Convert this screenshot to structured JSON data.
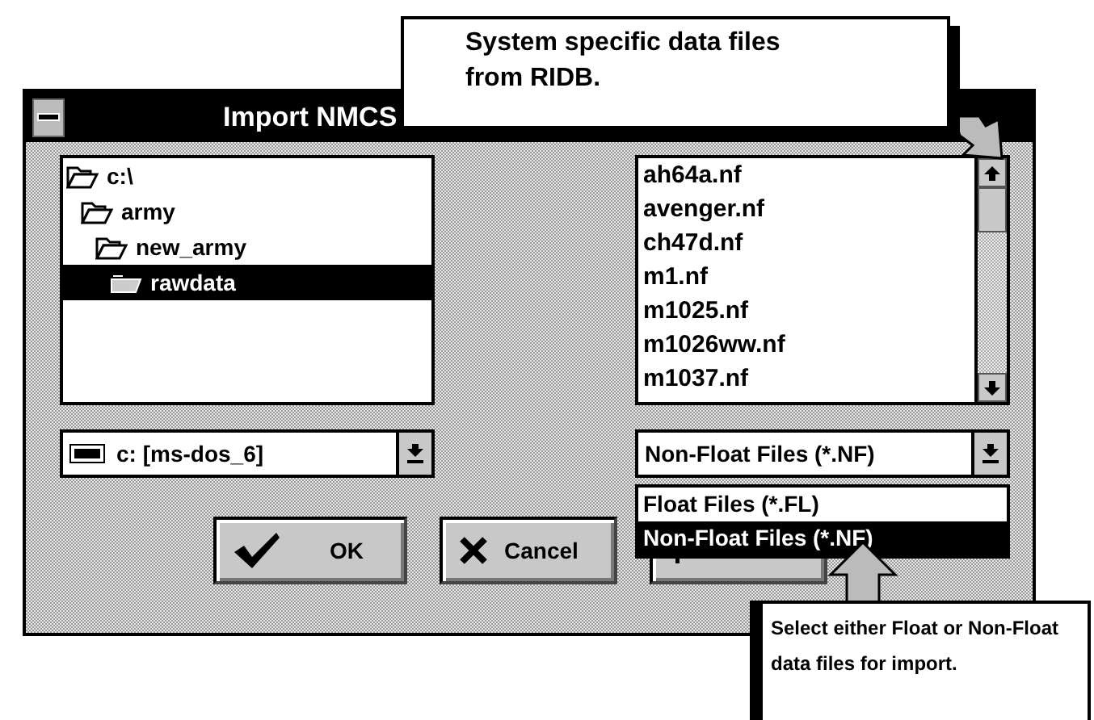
{
  "window": {
    "title": "Import NMCS"
  },
  "directories": [
    {
      "name": "c:\\",
      "selected": false,
      "children": [
        {
          "name": "army",
          "selected": false,
          "children": [
            {
              "name": "new_army",
              "selected": false,
              "children": [
                {
                  "name": "rawdata",
                  "selected": true
                }
              ]
            }
          ]
        }
      ]
    }
  ],
  "files": [
    "ah64a.nf",
    "avenger.nf",
    "ch47d.nf",
    "m1.nf",
    "m1025.nf",
    "m1026ww.nf",
    "m1037.nf"
  ],
  "drive": {
    "value": "c: [ms-dos_6]"
  },
  "file_type": {
    "value": "Non-Float Files (*.NF)",
    "expanded": true,
    "options": [
      {
        "label": "Float Files (*.FL)",
        "selected": false
      },
      {
        "label": "Non-Float Files (*.NF)",
        "selected": true
      }
    ]
  },
  "buttons": [
    {
      "kind": "ok",
      "label": "OK"
    },
    {
      "kind": "cancel",
      "label": "Cancel"
    },
    {
      "kind": "help"
    }
  ],
  "callouts": [
    {
      "kind": "top",
      "text": "System specific data files\nfrom RIDB."
    },
    {
      "kind": "bottom",
      "text": "Select either Float or Non-Float\ndata files for import."
    }
  ]
}
